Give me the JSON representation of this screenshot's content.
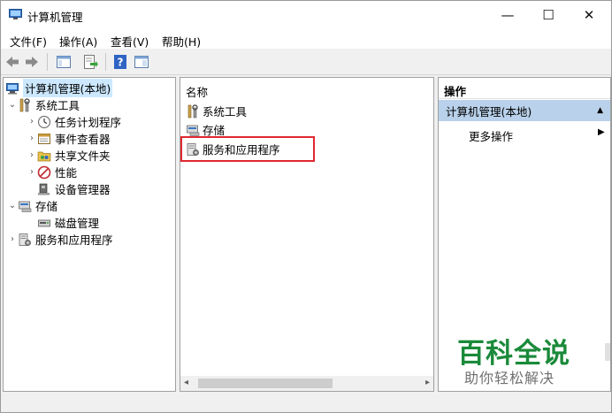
{
  "window": {
    "title": "计算机管理",
    "min_glyph": "—",
    "max_glyph": "☐",
    "close_glyph": "✕"
  },
  "menu": {
    "file": "文件(F)",
    "action": "操作(A)",
    "view": "查看(V)",
    "help": "帮助(H)"
  },
  "toolbar": {
    "back_icon": "back-arrow-icon",
    "forward_icon": "forward-arrow-icon",
    "show_tree_icon": "console-tree-icon",
    "export_icon": "export-list-icon",
    "help_icon": "help-icon",
    "show_action_icon": "action-pane-icon"
  },
  "tree": {
    "root": "计算机管理(本地)",
    "system_tools": "系统工具",
    "task_scheduler": "任务计划程序",
    "event_viewer": "事件查看器",
    "shared_folders": "共享文件夹",
    "performance": "性能",
    "device_manager": "设备管理器",
    "storage": "存储",
    "disk_management": "磁盘管理",
    "services_apps": "服务和应用程序"
  },
  "list": {
    "header": "名称",
    "items": [
      "系统工具",
      "存储",
      "服务和应用程序"
    ]
  },
  "actions": {
    "header": "操作",
    "selected": "计算机管理(本地)",
    "more": "更多操作"
  },
  "watermark": {
    "title": "百科全说",
    "subtitle": "助你轻松解决"
  },
  "colors": {
    "selection": "#cce8ff",
    "action_selected": "#b9d1ea",
    "highlight_border": "#e0282f",
    "watermark_green": "#1a8a3a"
  }
}
